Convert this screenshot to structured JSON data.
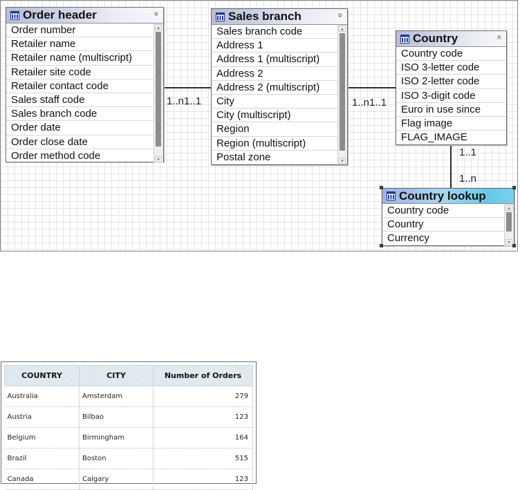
{
  "diagram": {
    "entities": {
      "order_header": {
        "title": "Order header",
        "collapse_glyph": "»",
        "items": [
          "Order number",
          "Retailer name",
          "Retailer name (multiscript)",
          "Retailer site code",
          "Retailer contact code",
          "Sales staff code",
          "Sales branch code",
          "Order date",
          "Order close date",
          "Order method code"
        ]
      },
      "sales_branch": {
        "title": "Sales branch",
        "collapse_glyph": "»",
        "items": [
          "Sales branch code",
          "Address 1",
          "Address 1 (multiscript)",
          "Address 2",
          "Address 2 (multiscript)",
          "City",
          "City (multiscript)",
          "Region",
          "Region (multiscript)",
          "Postal zone"
        ]
      },
      "country": {
        "title": "Country",
        "collapse_glyph": "«",
        "items": [
          "Country code",
          "ISO 3-letter code",
          "ISO 2-letter code",
          "ISO 3-digit code",
          "Euro in use since",
          "Flag image",
          "FLAG_IMAGE"
        ]
      },
      "country_lookup": {
        "title": "Country lookup",
        "items": [
          "Country code",
          "Country",
          "Currency"
        ]
      }
    },
    "relationships": {
      "order_to_branch": "1..n1..1",
      "branch_to_country": "1..n1..1",
      "country_side": "1..1",
      "lookup_side": "1..n"
    }
  },
  "report": {
    "columns": [
      "COUNTRY",
      "CITY",
      "Number of Orders"
    ],
    "rows": [
      [
        "Australia",
        "Amsterdam",
        "279"
      ],
      [
        "Austria",
        "Bilbao",
        "123"
      ],
      [
        "Belgium",
        "Birmingham",
        "164"
      ],
      [
        "Brazil",
        "Boston",
        "515"
      ],
      [
        "Canada",
        "Calgary",
        "123"
      ]
    ]
  }
}
